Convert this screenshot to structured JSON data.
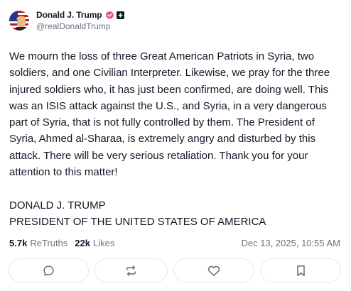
{
  "author": {
    "display_name": "Donald J. Trump",
    "handle": "@realDonaldTrump"
  },
  "post": {
    "body": "We mourn the loss of three Great American Patriots in Syria, two soldiers, and one Civilian Interpreter. Likewise, we pray for the three injured soldiers who, it has just been confirmed, are doing well. This was an ISIS attack against the U.S., and Syria, in a very dangerous part of Syria, that is not fully controlled by them. The President of Syria, Ahmed al-Sharaa, is extremely angry and disturbed by this attack. There will be very serious retaliation. Thank you for your attention to this matter!\n\nDONALD J. TRUMP\nPRESIDENT OF THE UNITED STATES OF AMERICA"
  },
  "stats": {
    "retruths_count": "5.7k",
    "retruths_label": "ReTruths",
    "likes_count": "22k",
    "likes_label": "Likes",
    "timestamp": "Dec 13, 2025, 10:55 AM"
  },
  "actions": [
    {
      "icon": "reply-icon"
    },
    {
      "icon": "retruth-icon"
    },
    {
      "icon": "like-icon"
    },
    {
      "icon": "bookmark-icon"
    }
  ],
  "colors": {
    "verified_badge": "#e5508c",
    "text_primary": "#111827",
    "text_muted": "#6b7280",
    "border": "#e5e7eb"
  }
}
